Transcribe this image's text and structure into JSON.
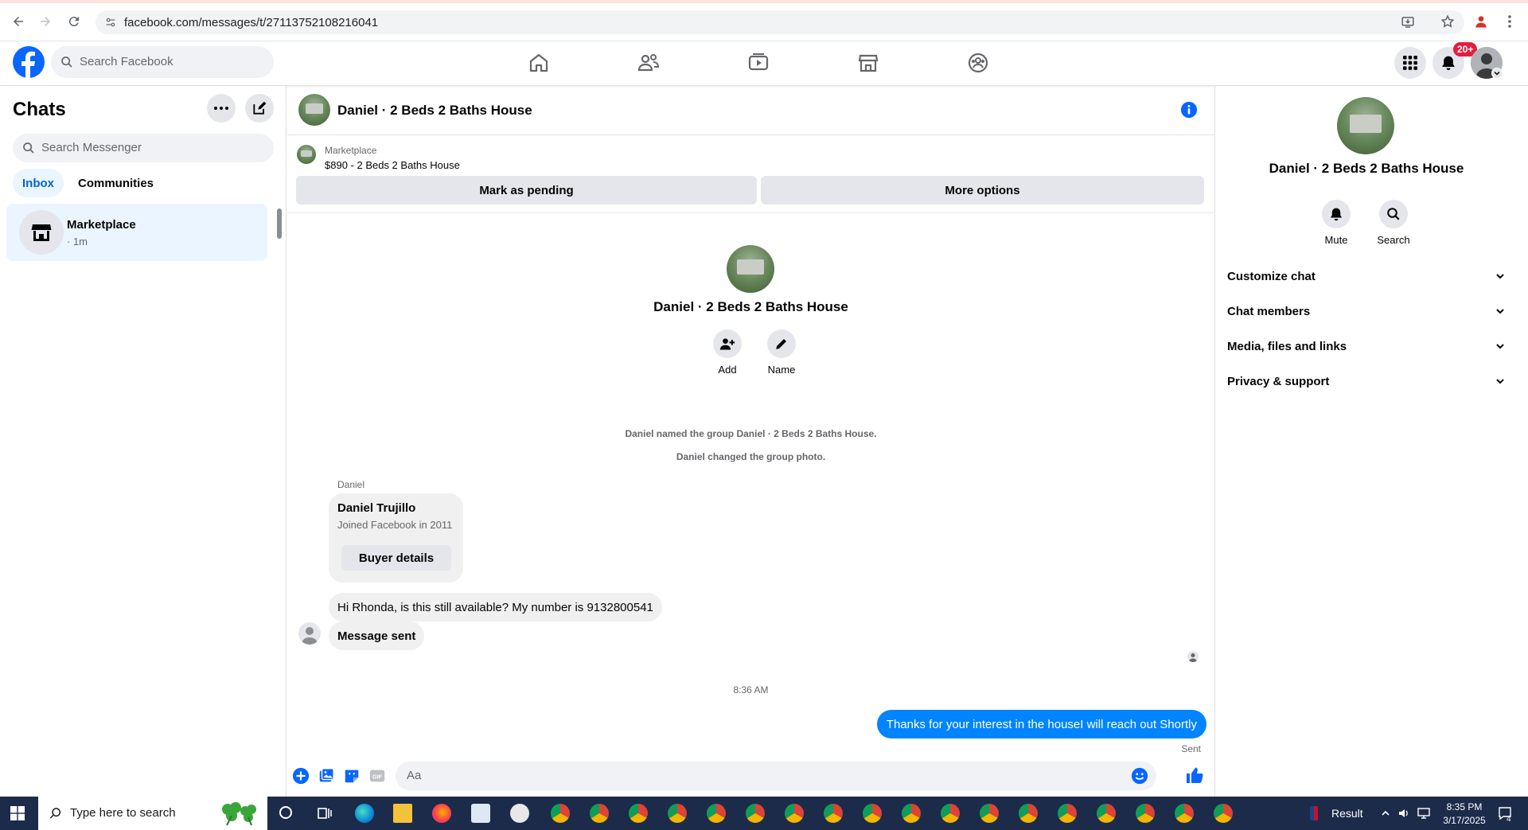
{
  "browser": {
    "url": "facebook.com/messages/t/27113752108216041"
  },
  "facebook": {
    "search_placeholder": "Search Facebook",
    "notification_badge": "20+"
  },
  "sidebar": {
    "title": "Chats",
    "search_placeholder": "Search Messenger",
    "tabs": [
      {
        "label": "Inbox",
        "active": true
      },
      {
        "label": "Communities",
        "active": false
      }
    ],
    "chats": [
      {
        "name": "Marketplace",
        "time": "· 1m"
      }
    ]
  },
  "conversation": {
    "title": "Daniel · 2 Beds 2 Baths House",
    "marketplace_label": "Marketplace",
    "listing": "$890 - 2 Beds 2 Baths House",
    "mark_pending_label": "Mark as pending",
    "more_options_label": "More options",
    "group_name": "Daniel · 2 Beds 2 Baths House",
    "add_label": "Add",
    "name_label": "Name",
    "system_messages": [
      "Daniel named the group Daniel · 2 Beds 2 Baths House.",
      "Daniel changed the group photo."
    ],
    "sender_name": "Daniel",
    "buyer_card": {
      "name": "Daniel Trujillo",
      "joined": "Joined Facebook in 2011",
      "button": "Buyer details"
    },
    "incoming_messages": [
      "Hi Rhonda, is this still available? My number is 9132800541",
      "Message sent"
    ],
    "timestamp": "8:36 AM",
    "outgoing_message": "Thanks for your interest in the houseI will reach out Shortly",
    "outgoing_status": "Sent",
    "composer_placeholder": "Aa"
  },
  "info_panel": {
    "title": "Daniel · 2 Beds 2 Baths House",
    "mute_label": "Mute",
    "search_label": "Search",
    "sections": [
      "Customize chat",
      "Chat members",
      "Media, files and links",
      "Privacy & support"
    ]
  },
  "taskbar": {
    "search_placeholder": "Type here to search",
    "result_label": "Result",
    "time": "8:35 PM",
    "date": "3/17/2025",
    "notification_count": "4"
  },
  "colors": {
    "facebook_blue": "#0866ff",
    "messenger_blue": "#0084ff",
    "taskbar": "#1c2b4a",
    "selected_chat": "#ebf5ff"
  }
}
